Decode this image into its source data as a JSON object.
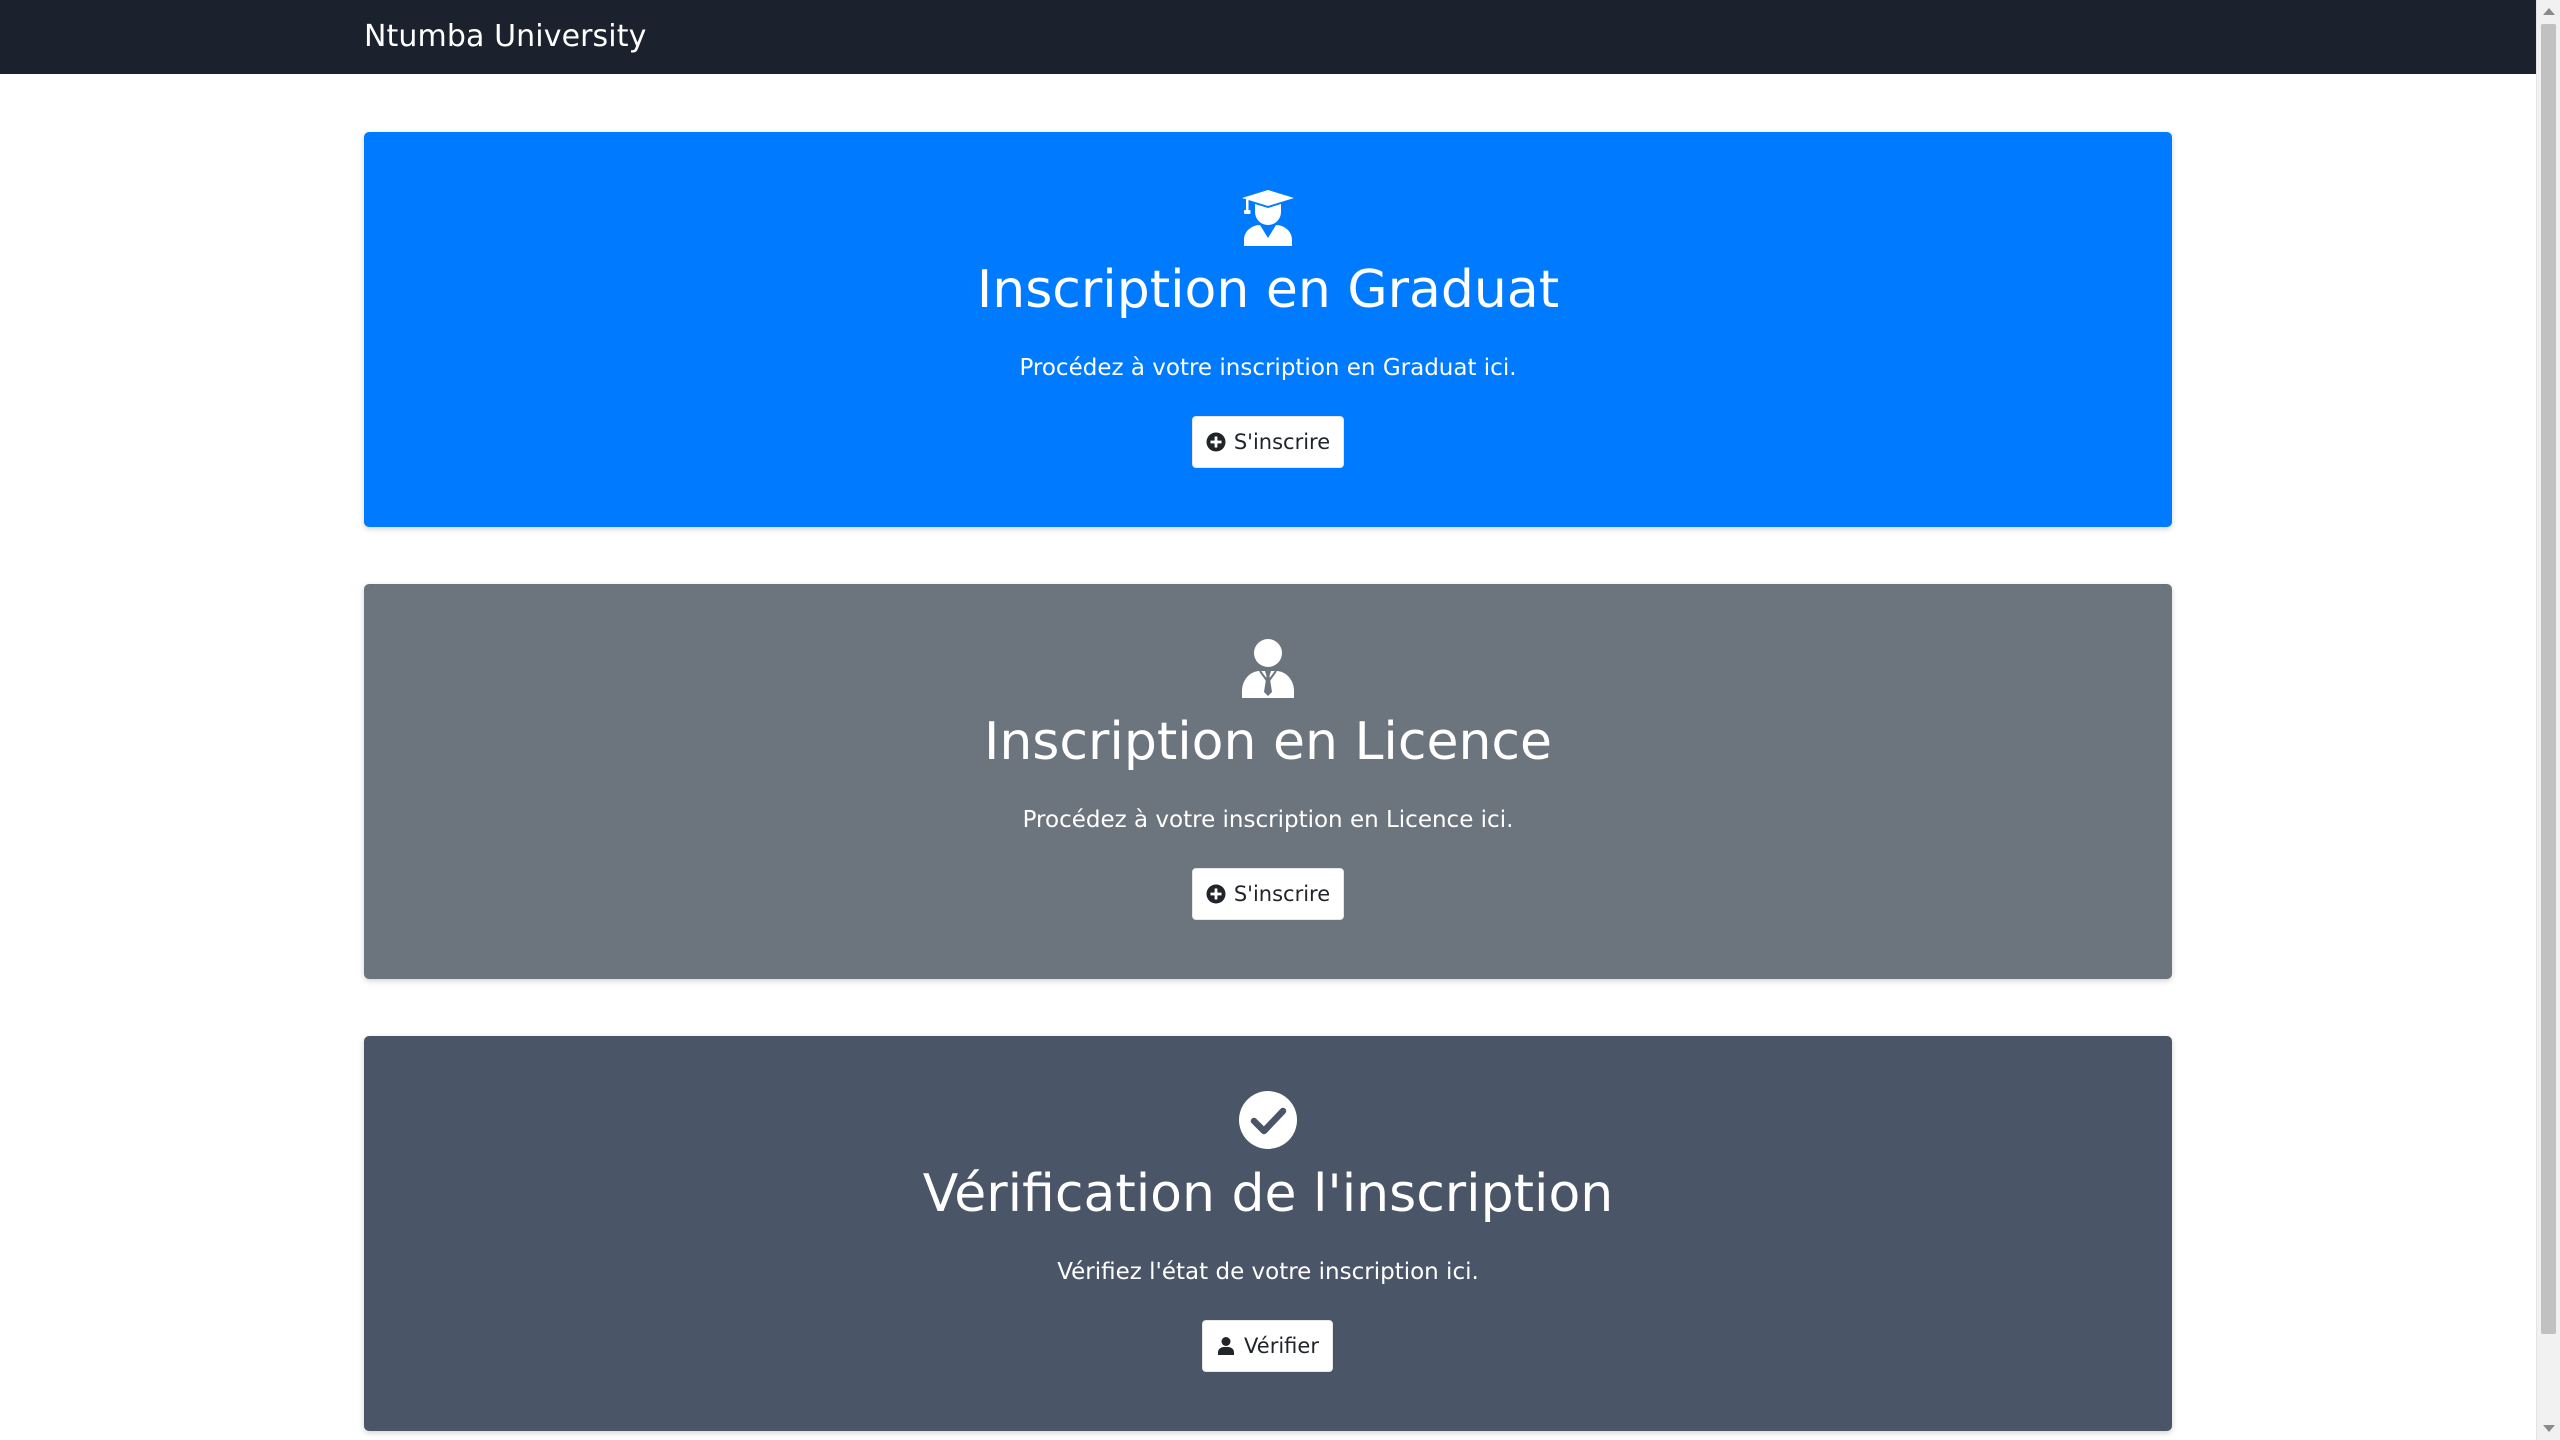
{
  "navbar": {
    "brand": "Ntumba University"
  },
  "cards": [
    {
      "icon": "graduate-icon",
      "title": "Inscription en Graduat",
      "description": "Procédez à votre inscription en Graduat ici.",
      "button_label": "S'inscrire",
      "button_icon": "plus-circle-icon",
      "color": "#007bff"
    },
    {
      "icon": "user-tie-icon",
      "title": "Inscription en Licence",
      "description": "Procédez à votre inscription en Licence ici.",
      "button_label": "S'inscrire",
      "button_icon": "plus-circle-icon",
      "color": "#6c757d"
    },
    {
      "icon": "check-circle-icon",
      "title": "Vérification de l'inscription",
      "description": "Vérifiez l'état de votre inscription ici.",
      "button_label": "Vérifier",
      "button_icon": "user-icon",
      "color": "#4b5568"
    }
  ],
  "colors": {
    "navbar": "#1b212d",
    "page_background": "#ffffff",
    "button_background": "#ffffff",
    "button_text": "#212529"
  }
}
